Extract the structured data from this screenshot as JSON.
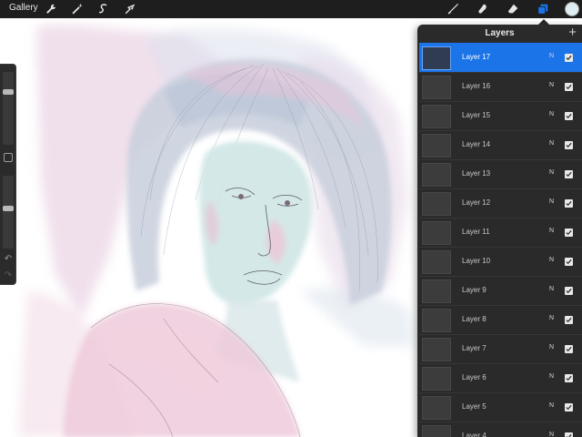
{
  "toolbar": {
    "gallery_label": "Gallery",
    "left_icons": [
      "wrench-icon",
      "magic-wand-icon",
      "selection-icon",
      "transform-arrow-icon"
    ],
    "right_icons": [
      "brush-icon",
      "smudge-icon",
      "eraser-icon",
      "layers-icon"
    ],
    "active_color": "#dfeef2",
    "layers_icon_color": "#1b74e8"
  },
  "sidebar": {
    "brush_size_level": 0.75,
    "opacity_level": 0.55
  },
  "layers": {
    "title": "Layers",
    "add_label": "+",
    "selected_color": "#1b74e8",
    "items": [
      {
        "name": "Layer 17",
        "blend": "N",
        "visible": true,
        "selected": true
      },
      {
        "name": "Layer 16",
        "blend": "N",
        "visible": true,
        "selected": false
      },
      {
        "name": "Layer 15",
        "blend": "N",
        "visible": true,
        "selected": false
      },
      {
        "name": "Layer 14",
        "blend": "N",
        "visible": true,
        "selected": false
      },
      {
        "name": "Layer 13",
        "blend": "N",
        "visible": true,
        "selected": false
      },
      {
        "name": "Layer 12",
        "blend": "N",
        "visible": true,
        "selected": false
      },
      {
        "name": "Layer 11",
        "blend": "N",
        "visible": true,
        "selected": false
      },
      {
        "name": "Layer 10",
        "blend": "N",
        "visible": true,
        "selected": false
      },
      {
        "name": "Layer 9",
        "blend": "N",
        "visible": true,
        "selected": false
      },
      {
        "name": "Layer 8",
        "blend": "N",
        "visible": true,
        "selected": false
      },
      {
        "name": "Layer 7",
        "blend": "N",
        "visible": true,
        "selected": false
      },
      {
        "name": "Layer 6",
        "blend": "N",
        "visible": true,
        "selected": false
      },
      {
        "name": "Layer 5",
        "blend": "N",
        "visible": true,
        "selected": false
      },
      {
        "name": "Layer 4",
        "blend": "N",
        "visible": true,
        "selected": false
      }
    ]
  }
}
